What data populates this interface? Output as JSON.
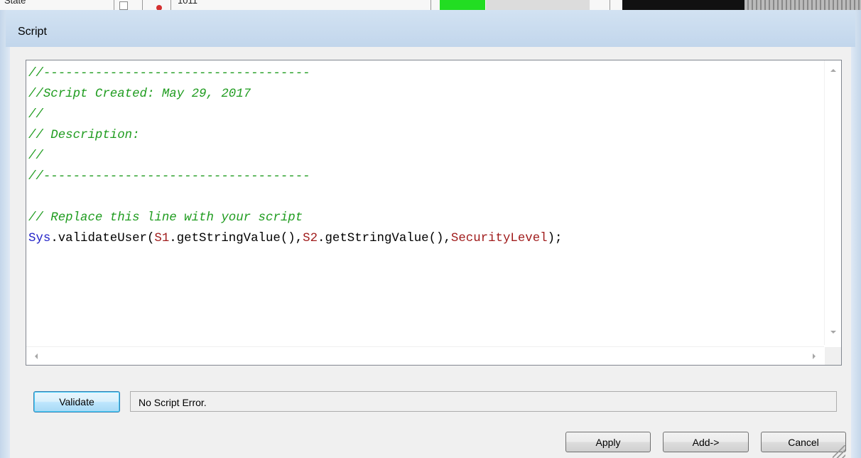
{
  "background_app": {
    "state_label": "State",
    "value_label": "1011"
  },
  "dialog": {
    "title": "Script"
  },
  "editor": {
    "lines": [
      [
        {
          "t": "//------------------------------------",
          "k": "comment"
        }
      ],
      [
        {
          "t": "//Script Created: May 29, 2017",
          "k": "comment"
        }
      ],
      [
        {
          "t": "//",
          "k": "comment"
        }
      ],
      [
        {
          "t": "// Description:",
          "k": "comment"
        }
      ],
      [
        {
          "t": "//",
          "k": "comment"
        }
      ],
      [
        {
          "t": "//------------------------------------",
          "k": "comment"
        }
      ],
      [
        {
          "t": "",
          "k": "plain"
        }
      ],
      [
        {
          "t": "// Replace this line with your script",
          "k": "comment"
        }
      ],
      [
        {
          "t": "Sys",
          "k": "obj"
        },
        {
          "t": ".validateUser(",
          "k": "plain"
        },
        {
          "t": "S1",
          "k": "var"
        },
        {
          "t": ".getStringValue(),",
          "k": "plain"
        },
        {
          "t": "S2",
          "k": "var"
        },
        {
          "t": ".getStringValue(),",
          "k": "plain"
        },
        {
          "t": "SecurityLevel",
          "k": "var"
        },
        {
          "t": ");",
          "k": "plain"
        }
      ]
    ],
    "colors": {
      "comment": "#1f9c1f",
      "obj": "#2323c8",
      "var": "#a01c1c",
      "plain": "#000000"
    }
  },
  "validate": {
    "button_label": "Validate",
    "status_text": "No Script Error."
  },
  "footer": {
    "apply_label": "Apply",
    "add_label": "Add->",
    "cancel_label": "Cancel"
  }
}
